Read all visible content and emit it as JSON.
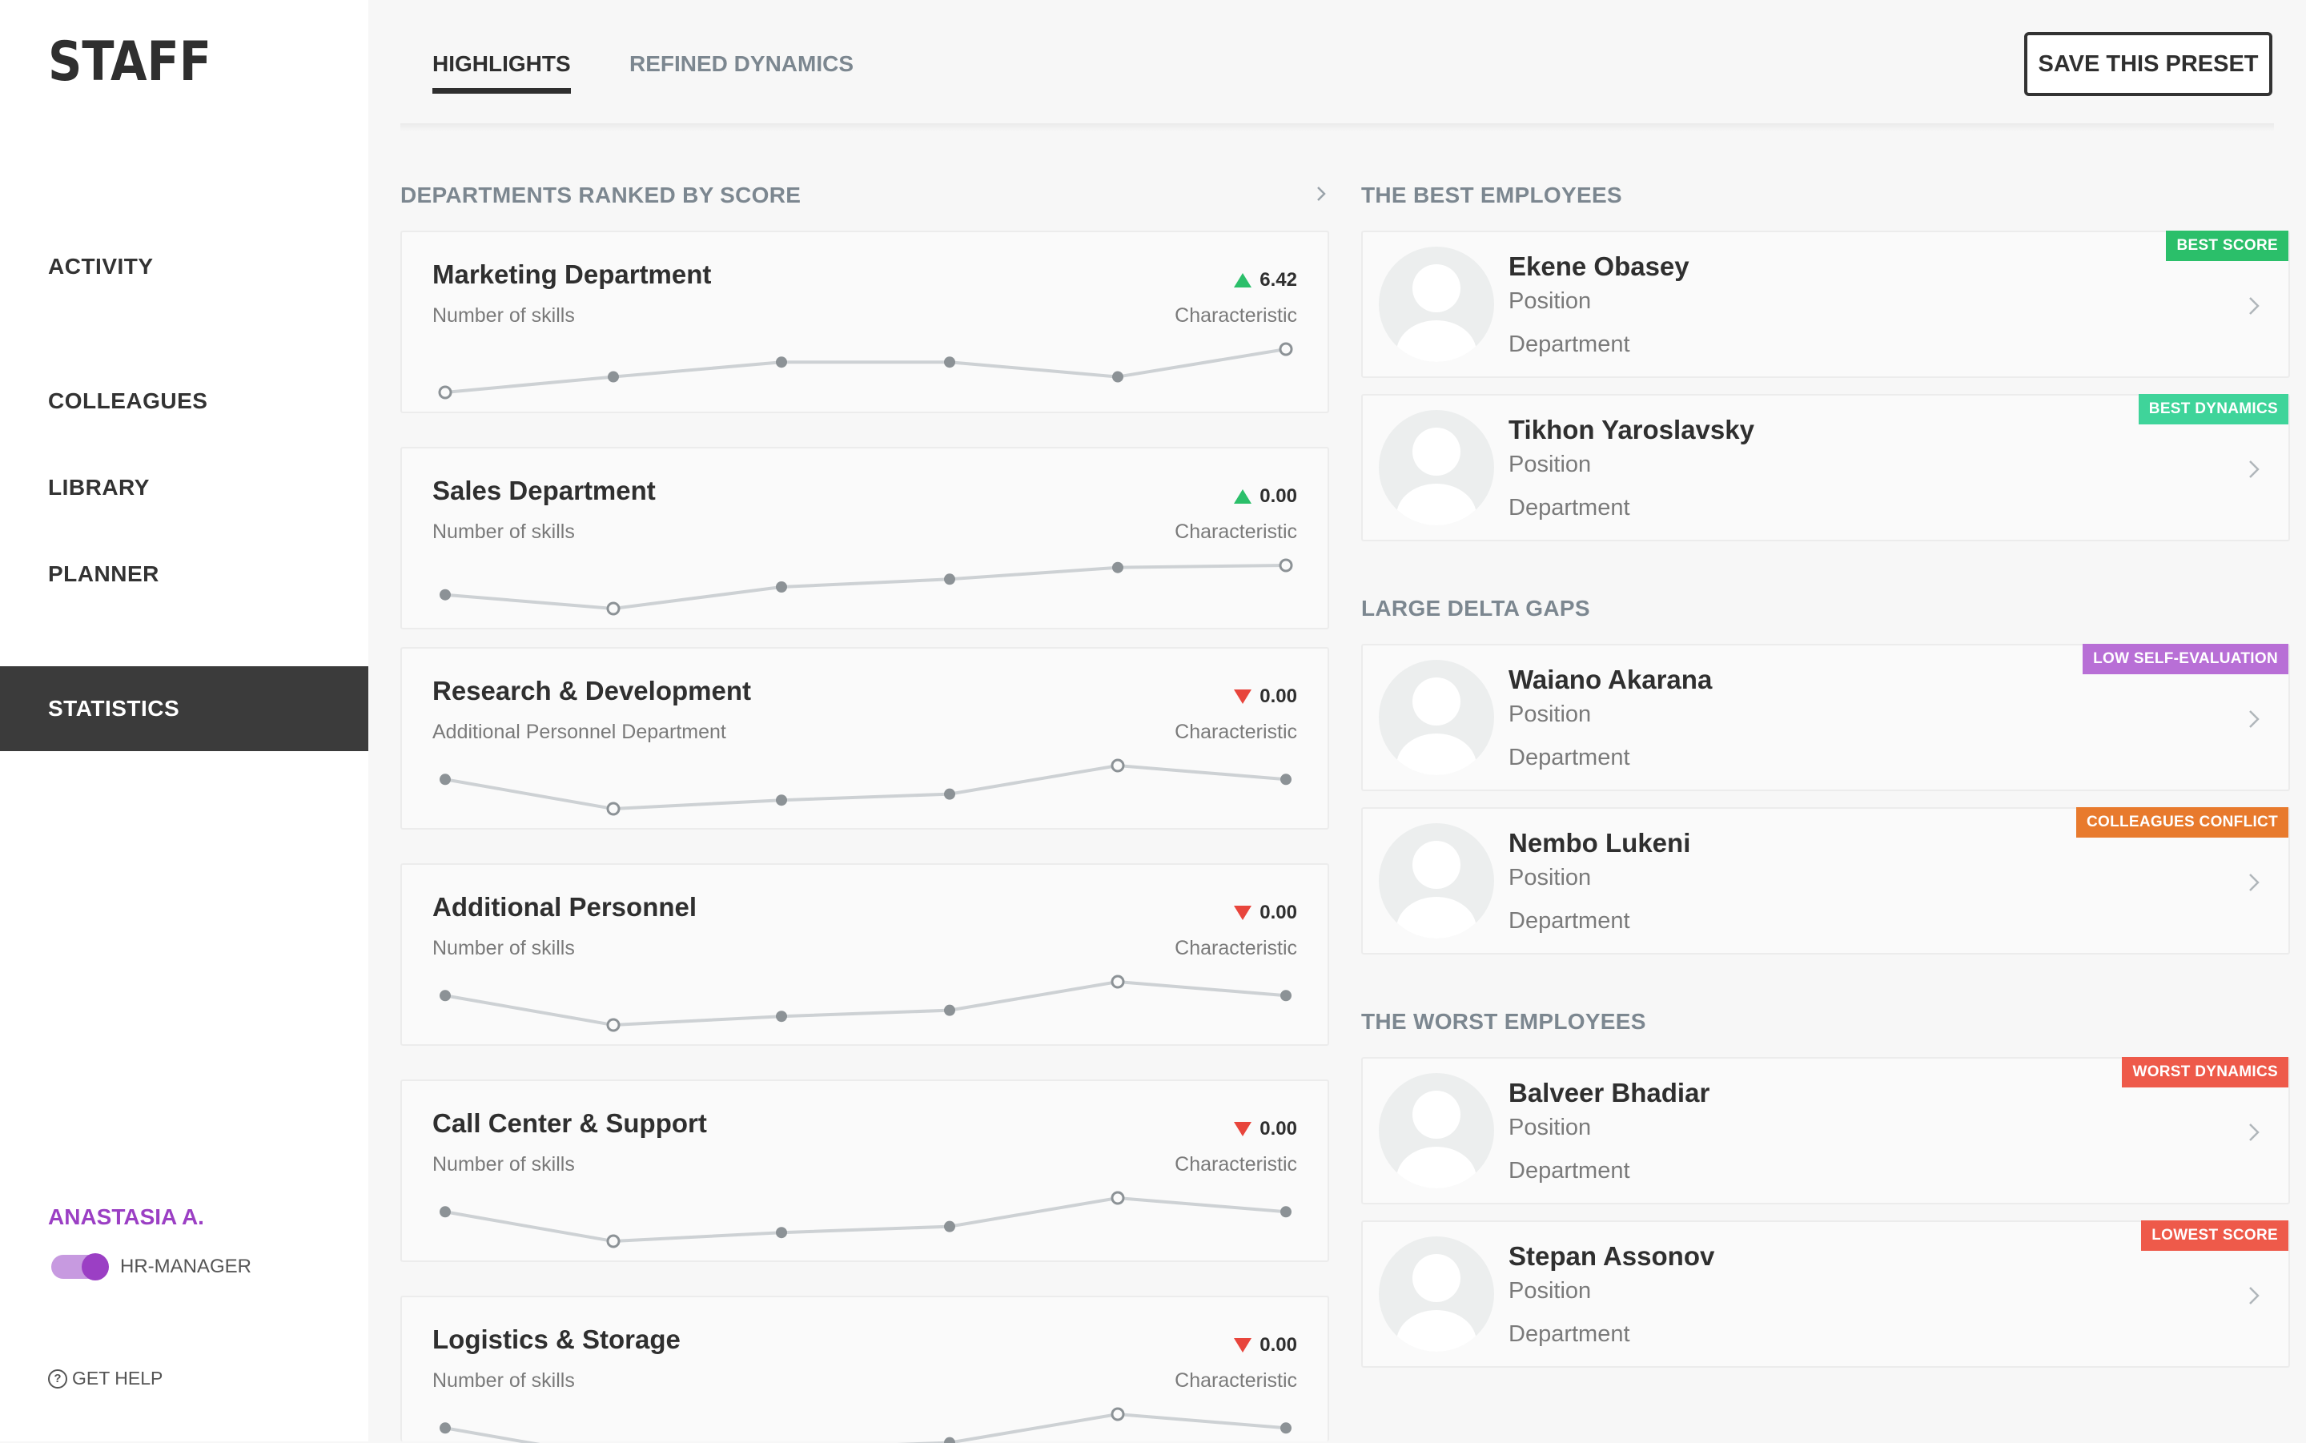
{
  "app": {
    "logo_text": "STAFF"
  },
  "sidebar": {
    "items": [
      {
        "label": "ACTIVITY",
        "active": false
      },
      {
        "label": "COLLEAGUES",
        "active": false
      },
      {
        "label": "LIBRARY",
        "active": false
      },
      {
        "label": "PLANNER",
        "active": false
      },
      {
        "label": "STATISTICS",
        "active": true
      }
    ],
    "user": {
      "name": "ANASTASIA A.",
      "role": "HR-MANAGER",
      "role_toggle_on": true
    },
    "help_label": "GET HELP"
  },
  "header": {
    "tabs": [
      {
        "label": "HIGHLIGHTS",
        "active": true
      },
      {
        "label": "REFINED DYNAMICS",
        "active": false
      }
    ],
    "save_label": "SAVE THIS PRESET"
  },
  "departments": {
    "title": "DEPARTMENTS RANKED BY SCORE",
    "items": [
      {
        "name": "Marketing Department",
        "subtitle": "Number of skills",
        "characteristic": "Characteristic",
        "value": "6.42",
        "trend": "up",
        "points": [
          0.0,
          0.36,
          0.7,
          0.7,
          0.36,
          1.0
        ],
        "hollow": [
          0,
          5
        ]
      },
      {
        "name": "Sales Department",
        "subtitle": "Number of skills",
        "characteristic": "Characteristic",
        "value": "0.00",
        "trend": "up",
        "points": [
          0.32,
          0.0,
          0.5,
          0.68,
          0.95,
          1.0
        ],
        "hollow": [
          1,
          5
        ]
      },
      {
        "name": "Research & Development",
        "subtitle": "Additional Personnel Department",
        "characteristic": "Characteristic",
        "value": "0.00",
        "trend": "down",
        "points": [
          0.68,
          0.0,
          0.2,
          0.34,
          1.0,
          0.68
        ],
        "hollow": [
          1,
          4
        ]
      },
      {
        "name": "Additional Personnel",
        "subtitle": "Number of skills",
        "characteristic": "Characteristic",
        "value": "0.00",
        "trend": "down",
        "points": [
          0.68,
          0.0,
          0.2,
          0.34,
          1.0,
          0.68
        ],
        "hollow": [
          1,
          4
        ]
      },
      {
        "name": "Call Center & Support",
        "subtitle": "Number of skills",
        "characteristic": "Characteristic",
        "value": "0.00",
        "trend": "down",
        "points": [
          0.68,
          0.0,
          0.2,
          0.34,
          1.0,
          0.68
        ],
        "hollow": [
          1,
          4
        ]
      },
      {
        "name": "Logistics & Storage",
        "subtitle": "Number of skills",
        "characteristic": "Characteristic",
        "value": "0.00",
        "trend": "down",
        "points": [
          0.68,
          0.0,
          0.2,
          0.34,
          1.0,
          0.68
        ],
        "hollow": [
          1,
          4
        ]
      }
    ]
  },
  "best_employees": {
    "title": "THE BEST EMPLOYEES",
    "items": [
      {
        "name": "Ekene Obasey",
        "position": "Position",
        "department": "Department",
        "badge": "BEST SCORE",
        "badge_color": "#2bbf6a"
      },
      {
        "name": "Tikhon Yaroslavsky",
        "position": "Position",
        "department": "Department",
        "badge": "BEST DYNAMICS",
        "badge_color": "#3fd49a"
      }
    ]
  },
  "delta_gaps": {
    "title": "LARGE DELTA GAPS",
    "items": [
      {
        "name": "Waiano Akarana",
        "position": "Position",
        "department": "Department",
        "badge": "LOW SELF-EVALUATION",
        "badge_color": "#b86fd6"
      },
      {
        "name": "Nembo Lukeni",
        "position": "Position",
        "department": "Department",
        "badge": "COLLEAGUES CONFLICT",
        "badge_color": "#e87a2d"
      }
    ]
  },
  "worst_employees": {
    "title": "THE WORST EMPLOYEES",
    "items": [
      {
        "name": "Balveer Bhadiar",
        "position": "Position",
        "department": "Department",
        "badge": "WORST DYNAMICS",
        "badge_color": "#ee5a4a"
      },
      {
        "name": "Stepan Assonov",
        "position": "Position",
        "department": "Department",
        "badge": "LOWEST SCORE",
        "badge_color": "#ee5a4a"
      }
    ]
  },
  "colors": {
    "accent": "#9b3fc4",
    "active_nav_bg": "#3b3b3b",
    "up": "#2bbf6a",
    "down": "#e8453c"
  }
}
